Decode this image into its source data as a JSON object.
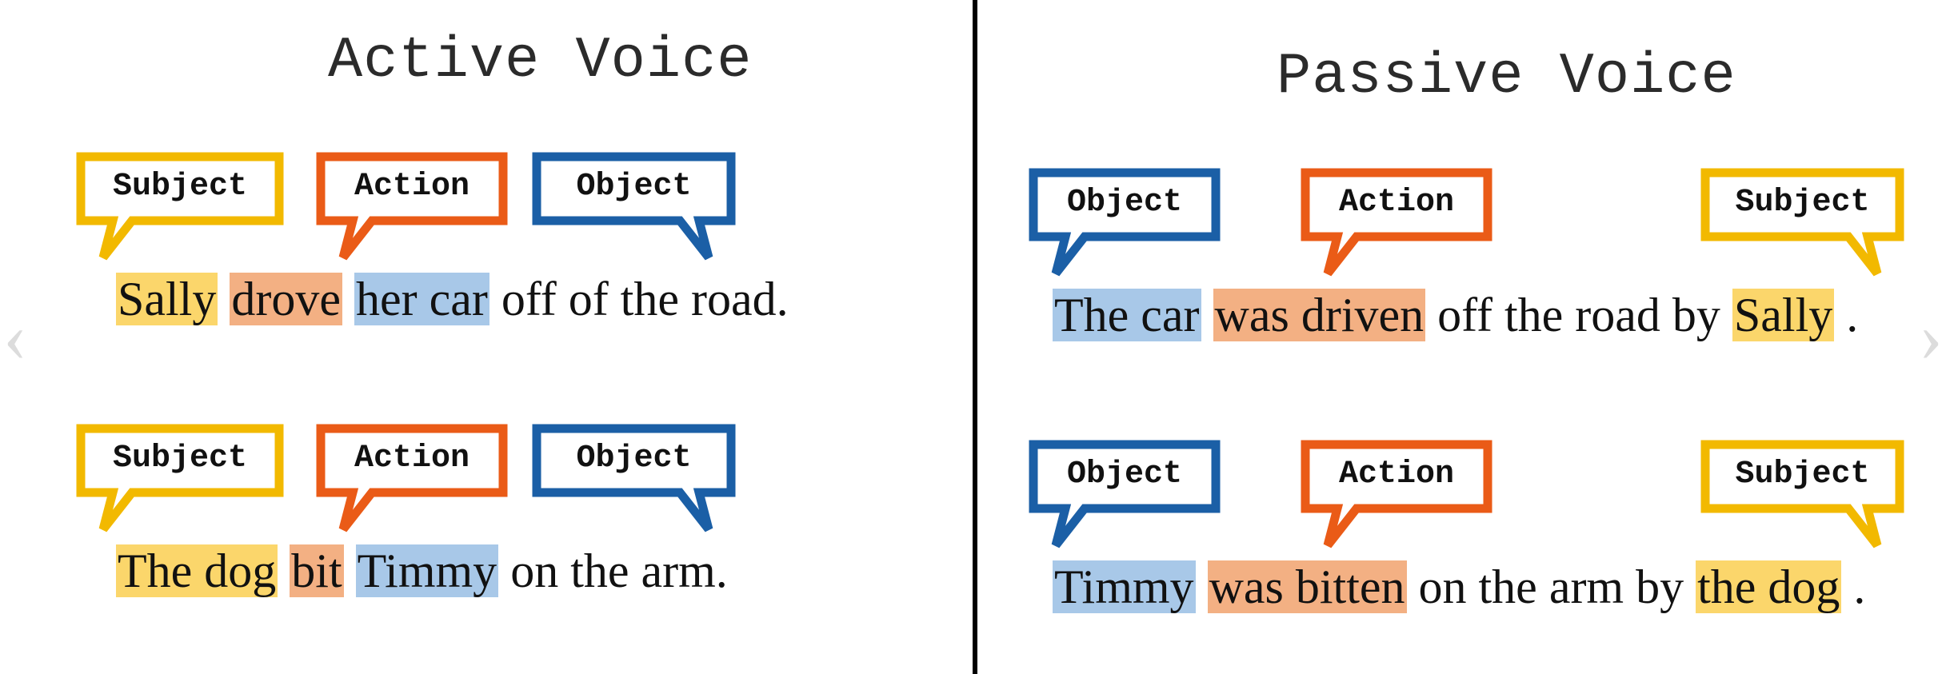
{
  "colors": {
    "subject_border": "#f2b900",
    "action_border": "#ea5b17",
    "object_border": "#1b5fa6",
    "subject_fill": "#fbd66b",
    "action_fill": "#f3b083",
    "object_fill": "#a8c8e8"
  },
  "nav": {
    "prev_glyph": "‹",
    "next_glyph": "›"
  },
  "left": {
    "title": "Active Voice",
    "row1": {
      "labels": {
        "subject": "Subject",
        "action": "Action",
        "object": "Object"
      },
      "sent": {
        "subject": "Sally",
        "action": "drove",
        "object": "her car",
        "rest": " off of the road."
      }
    },
    "row2": {
      "labels": {
        "subject": "Subject",
        "action": "Action",
        "object": "Object"
      },
      "sent": {
        "subject": "The dog",
        "action": "bit",
        "object": "Timmy",
        "rest": " on the arm."
      }
    }
  },
  "right": {
    "title": "Passive Voice",
    "row1": {
      "labels": {
        "object": "Object",
        "action": "Action",
        "subject": "Subject"
      },
      "sent": {
        "object": "The car",
        "action": "was driven",
        "mid": " off the road by ",
        "subject": "Sally",
        "end": "."
      }
    },
    "row2": {
      "labels": {
        "object": "Object",
        "action": "Action",
        "subject": "Subject"
      },
      "sent": {
        "object": "Timmy",
        "action": "was bitten",
        "mid": " on the arm by ",
        "subject": "the dog",
        "end": "."
      }
    }
  }
}
